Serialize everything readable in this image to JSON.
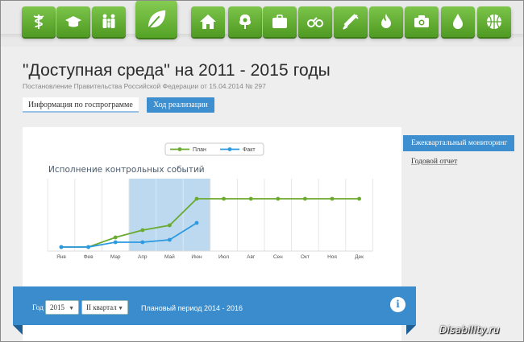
{
  "nav": {
    "icons": [
      {
        "name": "caduceus-icon"
      },
      {
        "name": "graduation-cap-icon"
      },
      {
        "name": "family-icon"
      },
      {
        "name": "leaf-icon",
        "selected": true
      },
      {
        "name": "home-icon"
      },
      {
        "name": "tree-icon"
      },
      {
        "name": "briefcase-icon"
      },
      {
        "name": "handcuffs-icon"
      },
      {
        "name": "syringe-icon"
      },
      {
        "name": "flame-icon"
      },
      {
        "name": "camera-icon"
      },
      {
        "name": "water-drop-icon"
      },
      {
        "name": "basketball-icon"
      }
    ]
  },
  "header": {
    "title": "\"Доступная среда\" на 2011 - 2015 годы",
    "subtitle": "Постановление Правительства Российской Федерации от 15.04.2014 № 297"
  },
  "tabs": {
    "info": "Информация по госпрограмме",
    "progress": "Ход реализации"
  },
  "sidebar": {
    "active": "Ежеквартальный мониторинг",
    "link": "Годовой отчет"
  },
  "filters": {
    "year_label": "Год",
    "year_value": "2015",
    "quarter_value": "II квартал",
    "planning_period": "Плановый период 2014 - 2016",
    "info_glyph": "i"
  },
  "watermark": "Disability.ru",
  "colors": {
    "accent_blue": "#3d8fd0",
    "nav_green": "#5aa92b",
    "plan_green": "#6aaa2f",
    "fact_blue": "#2c9ae0",
    "highlight": "#bdd9ef"
  },
  "chart_data": {
    "type": "line",
    "title": "Исполнение контрольных событий",
    "categories": [
      "Янв",
      "Фев",
      "Мар",
      "Апр",
      "Май",
      "Июн",
      "Июл",
      "Авг",
      "Сен",
      "Окт",
      "Ноя",
      "Дек"
    ],
    "series": [
      {
        "name": "План",
        "values": [
          0,
          0,
          2,
          3.5,
          4.5,
          10,
          10,
          10,
          10,
          10,
          10,
          10
        ]
      },
      {
        "name": "Факт",
        "values": [
          0,
          0,
          1,
          1,
          1.5,
          5,
          null,
          null,
          null,
          null,
          null,
          null
        ]
      }
    ],
    "highlight_categories": [
      "Апр",
      "Май",
      "Июн"
    ],
    "ylim": [
      0,
      10
    ],
    "legend_position": "top-center",
    "grid": "vertical"
  }
}
